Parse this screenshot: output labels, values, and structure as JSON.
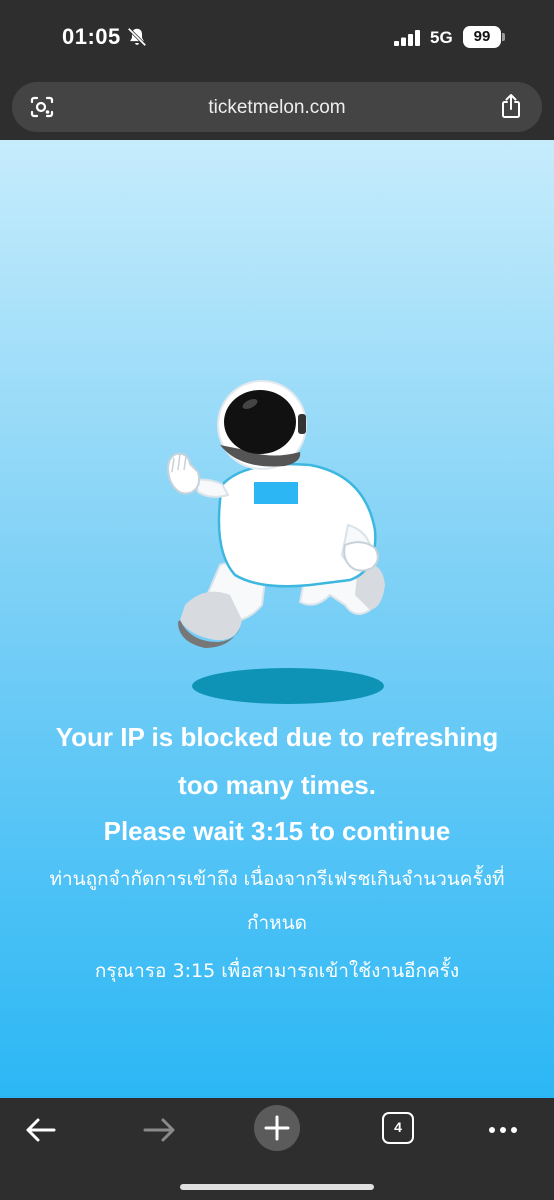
{
  "status_bar": {
    "time": "01:05",
    "network": "5G",
    "battery": "99",
    "icons": [
      "bell-slash-icon",
      "signal-icon",
      "battery-icon"
    ]
  },
  "browser": {
    "url": "ticketmelon.com",
    "icons": [
      "lens-icon",
      "share-icon"
    ]
  },
  "page": {
    "message_line1": "Your IP is blocked due to refreshing",
    "message_line2": "too many times.",
    "message_line3": "Please wait 3:15 to continue",
    "thai_line1": "ท่านถูกจำกัดการเข้าถึง เนื่องจากรีเฟรชเกินจำนวนครั้งที่",
    "thai_line2": "กำหนด",
    "thai_line3": "กรุณารอ 3:15 เพื่อสามารถเข้าใช้งานอีกครั้ง",
    "illustration": "astronaut-running"
  },
  "bottom_bar": {
    "tab_count": "4",
    "icons": [
      "back-arrow-icon",
      "forward-arrow-icon",
      "plus-icon",
      "tabs-icon",
      "more-icon"
    ]
  },
  "colors": {
    "bar_bg": "#2e2e2e",
    "gradient_top": "#c6ecfc",
    "gradient_bottom": "#2bb7f5",
    "visor_accent": "#2cb6f3"
  }
}
